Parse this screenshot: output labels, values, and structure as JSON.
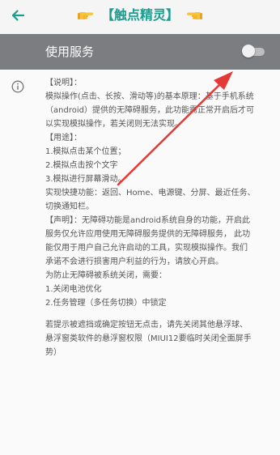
{
  "colors": {
    "accent": "#1e9c8f",
    "service_bar": "#7c7d81",
    "annotation_arrow": "#e53935"
  },
  "appbar": {
    "back_icon": "arrow-left-icon",
    "title": "【触点精灵】",
    "hand_icon": "pointing-hand-emoji"
  },
  "service": {
    "label": "使用服务",
    "enabled": false
  },
  "info": {
    "icon": "info-icon",
    "lines": [
      "【说明】：",
      "模拟操作(点击、长按、滑动等)的基本原理：基于手机系统",
      "（android）提供的无障碍服务，此功能需正常开启后才可",
      "以实现模拟操作，若关闭则无法实现。",
      "【用途】：",
      "1.模拟点击某个位置；",
      "2.模拟点击按个文字",
      "3.模拟进行屏幕滑动。",
      "实现快捷功能：返回、Home、电源键、分屏、最近任务、",
      "切换通知栏。",
      "【声明】：无障碍功能是android系统自身的功能，开启此",
      "服务仅允许应用使用无障碍服务提供的无障碍服务，  此功",
      "能仅用于用户自己允许启动的工具，实现模拟操作。我们",
      "承诺不会进行损害用户利益的行为，请放心开启。",
      "为防止无障碍被系统关闭，需要：",
      "1.关闭电池优化",
      "2.任务管理（多任务切换）中锁定"
    ],
    "note_lines": [
      "若提示被遮挡或确定按钮无点击，请先关闭其他悬浮球、",
      "悬浮窗类软件的悬浮窗权限（MIUI12要临时关闭全面屏手",
      "势）"
    ]
  }
}
